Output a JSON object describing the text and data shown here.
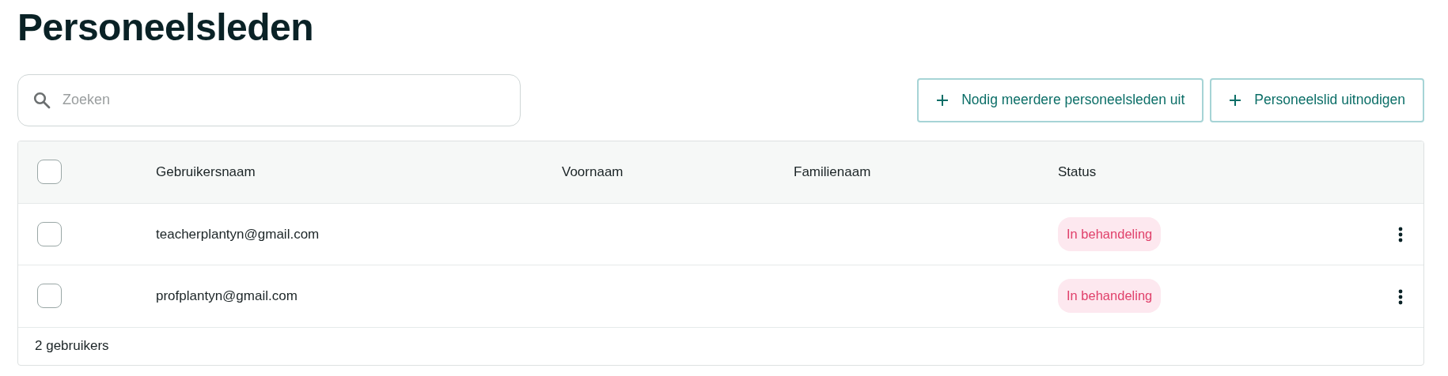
{
  "title": "Personeelsleden",
  "search": {
    "placeholder": "Zoeken"
  },
  "buttons": [
    {
      "label": "Nodig meerdere personeelsleden uit"
    },
    {
      "label": "Personeelslid uitnodigen"
    }
  ],
  "table": {
    "select_all": {
      "checked": false
    },
    "columns": [
      "Gebruikersnaam",
      "Voornaam",
      "Familienaam",
      "Status"
    ],
    "rows": [
      {
        "checked": false,
        "username": "teacherplantyn@gmail.com",
        "status": "In behandeling"
      },
      {
        "checked": false,
        "username": "profplantyn@gmail.com",
        "status": "In behandeling"
      }
    ],
    "footer": "2 gebruikers"
  }
}
